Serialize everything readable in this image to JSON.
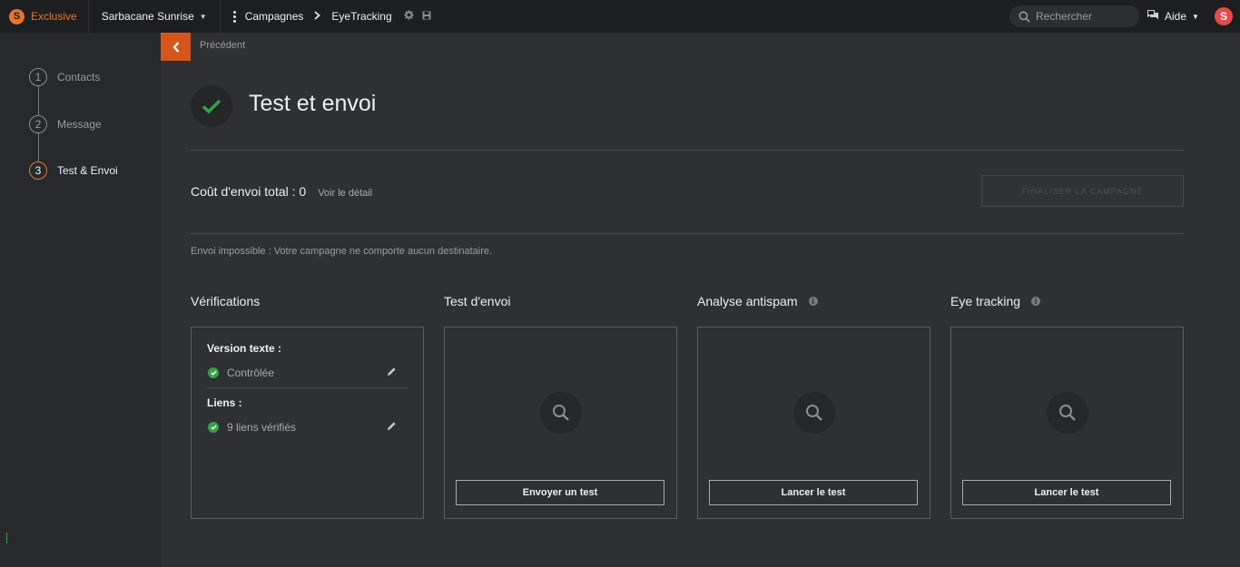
{
  "topbar": {
    "brand_letter": "S",
    "brand_name": "Exclusive",
    "account_name": "Sarbacane Sunrise",
    "breadcrumb": [
      "Campagnes",
      "EyeTracking"
    ],
    "search_placeholder": "Rechercher",
    "help_label": "Aide",
    "avatar_letter": "S"
  },
  "sidebar": {
    "steps": [
      {
        "num": "1",
        "label": "Contacts"
      },
      {
        "num": "2",
        "label": "Message"
      },
      {
        "num": "3",
        "label": "Test & Envoi"
      }
    ]
  },
  "main": {
    "back_label": "Précédent",
    "title": "Test et envoi",
    "cost_label": "Coût d'envoi total : 0",
    "cost_link": "Voir le détail",
    "finalize_label": "FINALISER LA CAMPAGNE",
    "notice": "Envoi impossible : Votre campagne ne comporte aucun destinataire.",
    "verifications": {
      "title": "Vérifications",
      "text_version_title": "Version texte :",
      "text_version_status": "Contrôlée",
      "links_title": "Liens :",
      "links_status": "9 liens vérifiés"
    },
    "test_send": {
      "title": "Test d'envoi",
      "button": "Envoyer un test"
    },
    "antispam": {
      "title": "Analyse antispam",
      "button": "Lancer le test"
    },
    "eyetracking": {
      "title": "Eye tracking",
      "button": "Lancer le test"
    }
  },
  "colors": {
    "accent": "#e8742c",
    "back_button": "#d4561c",
    "success": "#3aa047",
    "avatar": "#e84a4a"
  }
}
